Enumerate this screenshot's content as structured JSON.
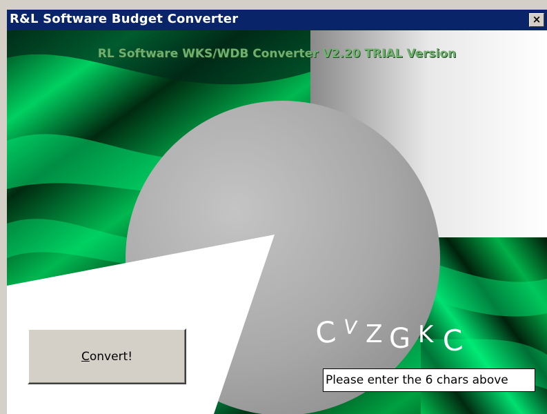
{
  "window": {
    "title": "R&L Software Budget Converter",
    "close_label": "×"
  },
  "header": {
    "text": "RL Software WKS/WDB Converter V2.20 TRIAL Version"
  },
  "convert_button": {
    "label_rest": "onvert!",
    "label_accesskey": "C"
  },
  "captcha": {
    "chars": [
      "C",
      "V",
      "Z",
      "G",
      "K",
      "C"
    ],
    "prompt": "Please enter the 6 chars above"
  },
  "colors": {
    "titlebar": "#0a246a",
    "accent_green": "#00c050",
    "button_face": "#d4d0c8"
  }
}
